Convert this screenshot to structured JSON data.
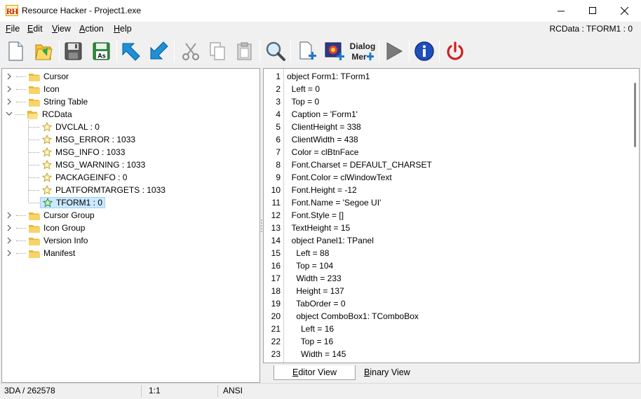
{
  "window": {
    "title": "Resource Hacker - Project1.exe",
    "app_icon_text": "RH"
  },
  "menu": {
    "items": [
      {
        "key": "F",
        "rest": "ile"
      },
      {
        "key": "E",
        "rest": "dit"
      },
      {
        "key": "V",
        "rest": "iew"
      },
      {
        "key": "A",
        "rest": "ction"
      },
      {
        "key": "H",
        "rest": "elp"
      }
    ],
    "current_resource": "RCData : TFORM1 : 0"
  },
  "toolbar": {
    "dialog_menu_label_line1": "Dialog",
    "dialog_menu_label_line2": "Mer",
    "open_as_label": "As"
  },
  "tree": {
    "groups": [
      {
        "label": "Cursor"
      },
      {
        "label": "Icon"
      },
      {
        "label": "String Table"
      },
      {
        "label": "RCData"
      },
      {
        "label": "Cursor Group"
      },
      {
        "label": "Icon Group"
      },
      {
        "label": "Version Info"
      },
      {
        "label": "Manifest"
      }
    ],
    "rcdata_children": [
      {
        "label": "DVCLAL : 0"
      },
      {
        "label": "MSG_ERROR : 1033"
      },
      {
        "label": "MSG_INFO : 1033"
      },
      {
        "label": "MSG_WARNING : 1033"
      },
      {
        "label": "PACKAGEINFO : 0"
      },
      {
        "label": "PLATFORMTARGETS : 1033"
      },
      {
        "label": "TFORM1 : 0"
      }
    ]
  },
  "editor": {
    "lines": [
      "object Form1: TForm1",
      "  Left = 0",
      "  Top = 0",
      "  Caption = 'Form1'",
      "  ClientHeight = 338",
      "  ClientWidth = 438",
      "  Color = clBtnFace",
      "  Font.Charset = DEFAULT_CHARSET",
      "  Font.Color = clWindowText",
      "  Font.Height = -12",
      "  Font.Name = 'Segoe UI'",
      "  Font.Style = []",
      "  TextHeight = 15",
      "  object Panel1: TPanel",
      "    Left = 88",
      "    Top = 104",
      "    Width = 233",
      "    Height = 137",
      "    TabOrder = 0",
      "    object ComboBox1: TComboBox",
      "      Left = 16",
      "      Top = 16",
      "      Width = 145"
    ],
    "line_numbers": [
      "1",
      "2",
      "3",
      "4",
      "5",
      "6",
      "7",
      "8",
      "9",
      "10",
      "11",
      "12",
      "13",
      "14",
      "15",
      "16",
      "17",
      "18",
      "19",
      "20",
      "21",
      "22",
      "23"
    ]
  },
  "tabs": {
    "editor": {
      "key": "E",
      "rest": "ditor View"
    },
    "binary": {
      "key": "B",
      "rest": "inary View"
    }
  },
  "status": {
    "size": "3DA / 262578",
    "position": "1:1",
    "encoding": "ANSI"
  }
}
